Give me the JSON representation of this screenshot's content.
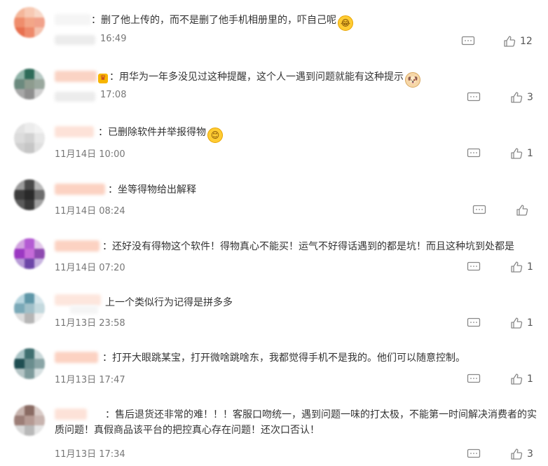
{
  "comments": [
    {
      "text": "：删了他上传的，而不是删了他手机相册里的，吓自己呢",
      "emoji": "😂",
      "time": "16:49",
      "likes": "12",
      "reply_icon": "reply-icon",
      "like_icon": "thumbs-up-icon"
    },
    {
      "text": "：用华为一年多没见过这种提醒，这个人一遇到问题就能有这种提示",
      "emoji": "🐶",
      "time": "17:08",
      "likes": "3",
      "reply_icon": "reply-icon",
      "like_icon": "thumbs-up-icon"
    },
    {
      "text": "：已删除软件并举报得物",
      "emoji": "😊",
      "time": "11月14日 10:00",
      "likes": "1",
      "reply_icon": "reply-icon",
      "like_icon": "thumbs-up-icon"
    },
    {
      "text": "：坐等得物给出解释",
      "emoji": "",
      "time": "11月14日 08:24",
      "likes": "",
      "reply_icon": "reply-icon",
      "like_icon": "thumbs-up-icon"
    },
    {
      "text": "：还好没有得物这个软件！得物真心不能买！运气不好得话遇到的都是坑！而且这种坑到处都是",
      "emoji": "",
      "time": "11月14日 07:20",
      "likes": "1",
      "reply_icon": "reply-icon",
      "like_icon": "thumbs-up-icon"
    },
    {
      "text": "上一个类似行为记得是拼多多",
      "emoji": "",
      "time": "11月13日 23:58",
      "likes": "1",
      "reply_icon": "reply-icon",
      "like_icon": "thumbs-up-icon"
    },
    {
      "text": "：打开大眼跳某宝，打开微啥跳啥东，我都觉得手机不是我的。他们可以随意控制。",
      "emoji": "",
      "time": "11月13日 17:47",
      "likes": "1",
      "reply_icon": "reply-icon",
      "like_icon": "thumbs-up-icon"
    },
    {
      "text": "：售后退货还非常的难！！！客服口吻统一，遇到问题一味的打太极，不能第一时间解决消费者的实质问题！真假商品该平台的把控真心存在问题！还次口否认！",
      "emoji": "",
      "time": "11月13日 17:34",
      "likes": "3",
      "reply_icon": "reply-icon",
      "like_icon": "thumbs-up-icon"
    }
  ]
}
